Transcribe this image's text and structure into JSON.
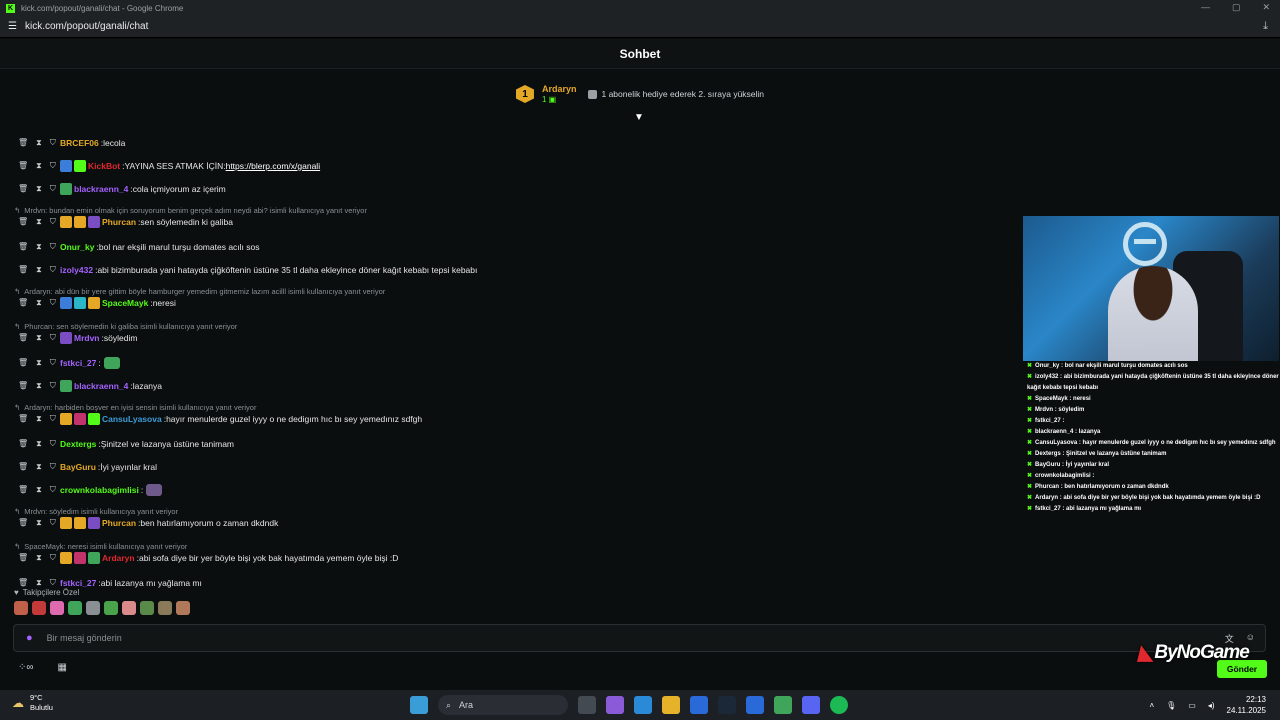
{
  "window": {
    "title": "kick.com/popout/ganali/chat - Google Chrome",
    "url": "kick.com/popout/ganali/chat"
  },
  "header": {
    "title": "Sohbet"
  },
  "pinned": {
    "rank": "1",
    "name": "Ardaryn",
    "sub_count": "1",
    "gift_text": "1 abonelik hediye ederek 2. sıraya yükselin"
  },
  "chat": {
    "messages": [
      {
        "reply": "",
        "user": "BRCEF06",
        "color": "#e5a826",
        "badges": [],
        "text": "lecola"
      },
      {
        "reply": "",
        "user": "KickBot",
        "color": "#e0282e",
        "badges": [
          "#3b7dd8",
          "#53fc18"
        ],
        "text": "YAYINA SES ATMAK İÇİN: ",
        "link": "https://blerp.com/x/ganali"
      },
      {
        "reply": "",
        "user": "blackraenn_4",
        "color": "#a463ff",
        "badges": [
          "#3ea55a"
        ],
        "text": "cola içmiyorum az içerim"
      },
      {
        "reply": "Mrdvn: bundan emin olmak için soruyorum benim gerçek adım neydi abi? isimli kullanıcıya yanıt veriyor",
        "user": "Phurcan",
        "color": "#e5a826",
        "badges": [
          "#e5a826",
          "#e5a826",
          "#7b4dc2"
        ],
        "text": "sen söylemedin ki galiba"
      },
      {
        "reply": "",
        "user": "Onur_ky",
        "color": "#53fc18",
        "badges": [],
        "text": "bol nar ekşili marul turşu domates acılı sos"
      },
      {
        "reply": "",
        "user": "izoly432",
        "color": "#a463ff",
        "badges": [],
        "text": "abi bizimburada yani hatayda çiğköftenin üstüne 35 tl daha ekleyince döner kağıt kebabı tepsi kebabı"
      },
      {
        "reply": "Ardaryn: abi dün bir yere gittim böyle hamburger yemedim gitmemiz lazım acilll isimli kullanıcıya yanıt veriyor",
        "user": "SpaceMayk",
        "color": "#53fc18",
        "badges": [
          "#3b7dd8",
          "#2bb6c8",
          "#e5a826"
        ],
        "text": "neresi"
      },
      {
        "reply": "Phurcan: sen söylemedin ki galiba isimli kullanıcıya yanıt veriyor",
        "user": "Mrdvn",
        "color": "#a463ff",
        "badges": [
          "#7b4dc2"
        ],
        "text": "söyledim"
      },
      {
        "reply": "",
        "user": "fstkci_27",
        "color": "#a463ff",
        "badges": [],
        "text": "",
        "emote": "#3ea55a"
      },
      {
        "reply": "",
        "user": "blackraenn_4",
        "color": "#a463ff",
        "badges": [
          "#3ea55a"
        ],
        "text": "lazanya"
      },
      {
        "reply": "Ardaryn: harbiden boşver en iyisi sensin isimli kullanıcıya yanıt veriyor",
        "user": "CansuLyasova",
        "color": "#3b9dd8",
        "badges": [
          "#e5a826",
          "#c2336b",
          "#53fc18"
        ],
        "text": "hayır menulerde guzel iyyy o ne dedigım hıc bı sey yemedınız sdfgh"
      },
      {
        "reply": "",
        "user": "Dextergs",
        "color": "#53fc18",
        "badges": [],
        "text": "Şinitzel ve lazanya üstüne tanimam"
      },
      {
        "reply": "",
        "user": "BayGuru",
        "color": "#e5a826",
        "badges": [],
        "text": "İyi yayınlar kral"
      },
      {
        "reply": "",
        "user": "crownkolabagimlisi",
        "color": "#53fc18",
        "badges": [],
        "text": "",
        "emote": "#6e5a8a"
      },
      {
        "reply": "Mrdvn: söyledim isimli kullanıcıya yanıt veriyor",
        "user": "Phurcan",
        "color": "#e5a826",
        "badges": [
          "#e5a826",
          "#e5a826",
          "#7b4dc2"
        ],
        "text": "ben hatırlamıyorum o zaman dkdndk"
      },
      {
        "reply": "SpaceMayk: neresi isimli kullanıcıya yanıt veriyor",
        "user": "Ardaryn",
        "color": "#e0282e",
        "badges": [
          "#e5a826",
          "#c2336b",
          "#3ea55a"
        ],
        "text": "abi sofa diye bir yer böyle bişi yok bak hayatımda yemem öyle bişi :D"
      },
      {
        "reply": "",
        "user": "fstkci_27",
        "color": "#a463ff",
        "badges": [],
        "text": "abi lazanya mı yağlama mı"
      }
    ]
  },
  "follower": {
    "label": "Takipçilere Özel"
  },
  "input": {
    "placeholder": "Bir mesaj gönderin",
    "send_label": "Gönder"
  },
  "overlay": {
    "lines": [
      "Onur_ky : bol nar ekşili marul turşu domates acılı sos",
      "izoly432 : abi bizimburada yani hatayda çiğköftenin üstüne 35 tl daha ekleyince döner kağıt kebabı tepsi kebabı",
      "SpaceMayk : neresi",
      "Mrdvn : söyledim",
      "fstkci_27 :",
      "blackraenn_4 : lazanya",
      "CansuLyasova : hayır menulerde guzel iyyy o ne dedigım hıc bı sey yemedınız sdfgh",
      "Dextergs : Şinitzel ve lazanya üstüne tanimam",
      "BayGuru : İyi yayınlar kral",
      "crownkolabagimlisi :",
      "Phurcan : ben hatırlamıyorum o zaman dkdndk",
      "Ardaryn : abi sofa diye bir yer böyle bişi yok bak hayatımda yemem öyle bişi :D",
      "fstkci_27 : abi lazanya mı yağlama mı"
    ]
  },
  "watermark": {
    "text": "ByNoGame"
  },
  "taskbar": {
    "weather_temp": "9°C",
    "weather_desc": "Bulutlu",
    "search": "Ara",
    "time": "22:13",
    "date": "24.11.2025"
  }
}
